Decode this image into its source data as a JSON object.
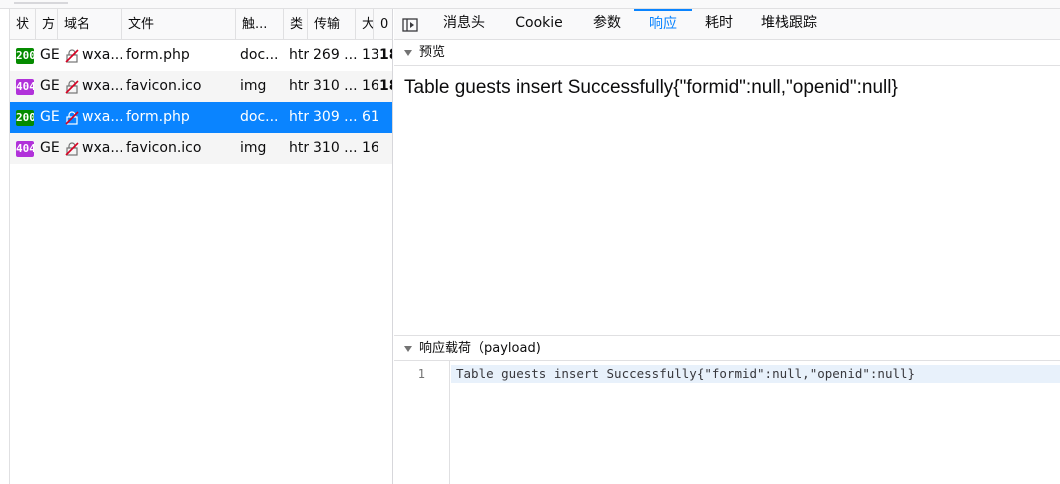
{
  "columns": {
    "status": "状",
    "method": "方",
    "domain": "域名",
    "file": "文件",
    "initiator": "触...",
    "type": "类",
    "transferred": "传输",
    "size": "大",
    "extra": "0"
  },
  "requests": [
    {
      "status": "200",
      "status_kind": "ok",
      "method": "GE",
      "domain": "wxa...",
      "file": "form.php",
      "initiator": "doc...",
      "type": "htr",
      "transferred": "269 ...",
      "size": "13",
      "extra": "18",
      "selected": false
    },
    {
      "status": "404",
      "status_kind": "redirect",
      "method": "GE",
      "domain": "wxa...",
      "file": "favicon.ico",
      "initiator": "img",
      "type": "htr",
      "transferred": "310 ...",
      "size": "16",
      "extra": "18",
      "selected": false
    },
    {
      "status": "200",
      "status_kind": "ok",
      "method": "GE",
      "domain": "wxa...",
      "file": "form.php",
      "initiator": "doc...",
      "type": "htr",
      "transferred": "309 ...",
      "size": "61",
      "extra": "",
      "selected": true
    },
    {
      "status": "404",
      "status_kind": "redirect",
      "method": "GE",
      "domain": "wxa...",
      "file": "favicon.ico",
      "initiator": "img",
      "type": "htr",
      "transferred": "310 ...",
      "size": "16",
      "extra": "",
      "selected": false
    }
  ],
  "tabs": {
    "headers": "消息头",
    "cookies": "Cookie",
    "params": "参数",
    "response": "响应",
    "timings": "耗时",
    "stack": "堆栈跟踪"
  },
  "active_tab": "response",
  "preview": {
    "label": "预览",
    "text": "Table guests insert Successfully{\"formid\":null,\"openid\":null}"
  },
  "payload": {
    "label": "响应载荷（payload)",
    "line_number": "1",
    "text": "Table guests insert Successfully{\"formid\":null,\"openid\":null}"
  },
  "colors": {
    "accent": "#0a84ff",
    "status_ok": "#058b00",
    "status_404": "#b132da"
  },
  "icons": {
    "lock": "insecure-lock-icon",
    "toggle": "sidebar-toggle-icon",
    "expand": "triangle-down-icon"
  }
}
